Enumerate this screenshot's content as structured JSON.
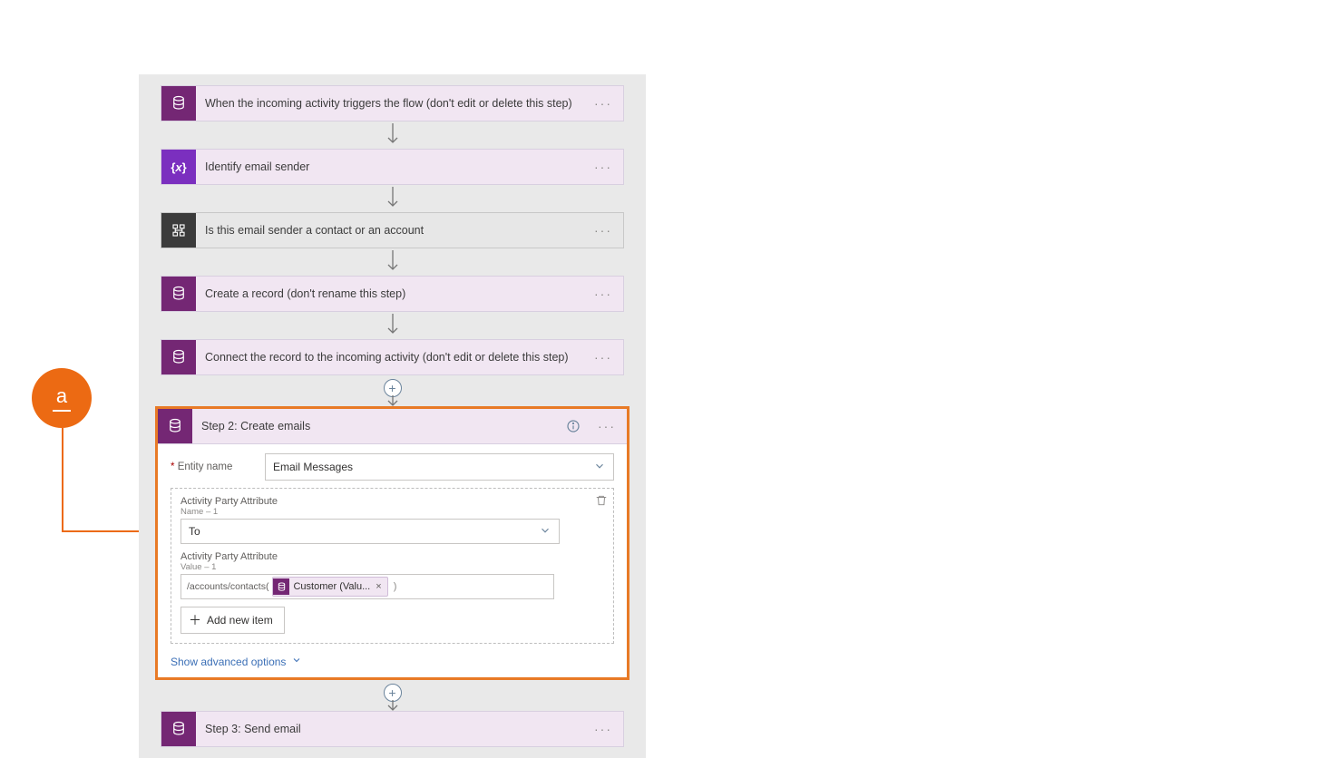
{
  "annotation": {
    "letter": "a"
  },
  "steps": {
    "s1": {
      "label": "When the incoming activity triggers the flow (don't edit or delete this step)"
    },
    "s2": {
      "label": "Identify email sender"
    },
    "s3": {
      "label": "Is this email sender a contact or an account"
    },
    "s4": {
      "label": "Create a record (don't rename this step)"
    },
    "s5": {
      "label": "Connect the record to the incoming activity (don't edit or delete this step)"
    },
    "s6": {
      "label": "Step 2: Create emails"
    },
    "s7": {
      "label": "Step 3: Send email"
    }
  },
  "createEmails": {
    "entityNameLabel": "Entity name",
    "entityNameRequired": "*",
    "entityNameValue": "Email Messages",
    "attrNameLabel": "Activity Party Attribute",
    "attrNameSub": "Name – 1",
    "attrNameValue": "To",
    "attrValueLabel": "Activity Party Attribute",
    "attrValueSub": "Value – 1",
    "attrValuePrefix": "/accounts/contacts(",
    "tokenLabel": "Customer (Valu...",
    "attrValueSuffix": ")",
    "addNewItem": "Add new item",
    "showAdvanced": "Show advanced options"
  }
}
